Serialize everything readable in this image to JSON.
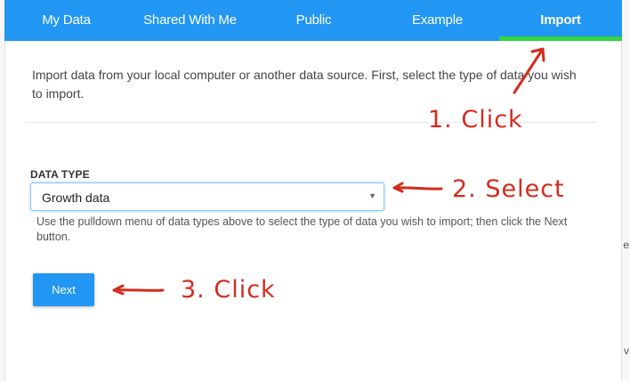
{
  "tabs": [
    {
      "label": "My Data",
      "active": false
    },
    {
      "label": "Shared With Me",
      "active": false
    },
    {
      "label": "Public",
      "active": false
    },
    {
      "label": "Example",
      "active": false
    },
    {
      "label": "Import",
      "active": true
    }
  ],
  "intro": "Import data from your local computer or another data source. First, select the type of data you wish to import.",
  "data_type": {
    "label": "DATA TYPE",
    "selected": "Growth data",
    "help": "Use the pulldown menu of data types above to select the type of data you wish to import; then click the Next button."
  },
  "next_label": "Next",
  "annotations": {
    "step1": "1. Click",
    "step2": "2. Select",
    "step3": "3. Click"
  },
  "edge_glyphs": [
    "e",
    "v"
  ],
  "colors": {
    "tab_bar": "#2196f3",
    "active_underline": "#32d73e",
    "annotation": "#d42b1e",
    "button": "#2196f3"
  }
}
